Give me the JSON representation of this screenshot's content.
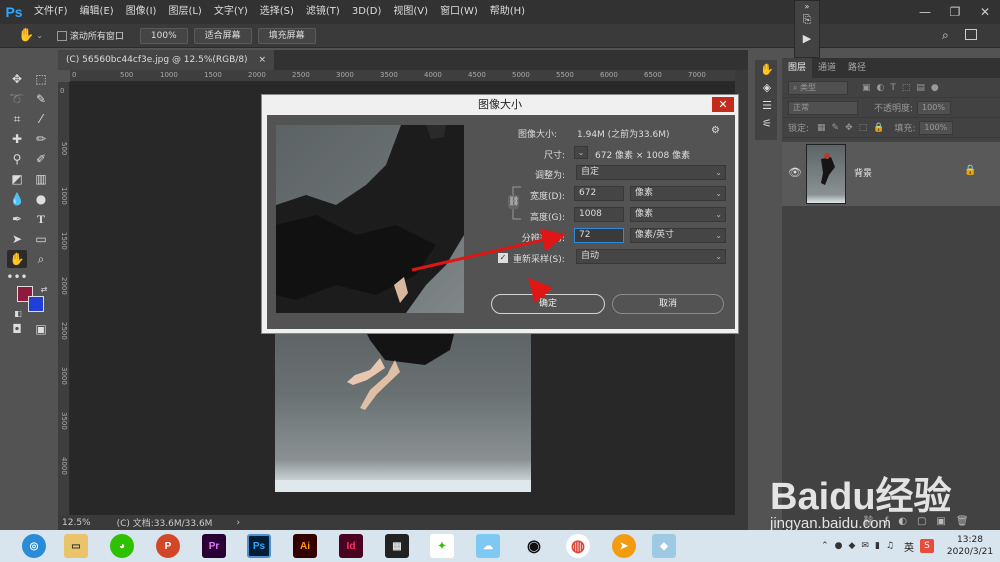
{
  "app": {
    "logo": "Ps"
  },
  "menu": [
    "文件(F)",
    "编辑(E)",
    "图像(I)",
    "图层(L)",
    "文字(Y)",
    "选择(S)",
    "滤镜(T)",
    "3D(D)",
    "视图(V)",
    "窗口(W)",
    "帮助(H)"
  ],
  "window_controls": {
    "minimize": "—",
    "restore": "❐",
    "close": "✕"
  },
  "options_bar": {
    "scroll_all_label": "滚动所有窗口",
    "zoom_100": "100%",
    "fit_screen": "适合屏幕",
    "fill_screen": "填充屏幕"
  },
  "document": {
    "tab_title": "(C) 56560bc44cf3e.jpg @ 12.5%(RGB/8)",
    "tab_close": "×",
    "zoom": "12.5%",
    "doc_size": "(C) 文档:33.6M/33.6M",
    "ruler_h": [
      "0",
      "500",
      "1000",
      "1500",
      "2000",
      "2500",
      "3000",
      "3500",
      "4000",
      "4500",
      "5000",
      "5500",
      "6000",
      "6500",
      "7000"
    ],
    "ruler_v": [
      "0",
      "500",
      "1000",
      "1500",
      "2000",
      "2500",
      "3000",
      "3500",
      "4000"
    ]
  },
  "layers_panel": {
    "tabs": [
      "图层",
      "通道",
      "路径"
    ],
    "kind_label": "类型",
    "blend_mode": "正常",
    "opacity_label": "不透明度:",
    "opacity_value": "100%",
    "lock_label": "锁定:",
    "fill_label": "填充:",
    "fill_value": "100%",
    "layer_name": "背景"
  },
  "dialog": {
    "title": "图像大小",
    "close": "✕",
    "image_size_label": "图像大小:",
    "image_size_value": "1.94M (之前为33.6M)",
    "dimensions_label": "尺寸:",
    "dimensions_value": "672 像素 × 1008 像素",
    "fit_to_label": "调整为:",
    "fit_to_value": "自定",
    "width_label": "宽度(D):",
    "width_value": "672",
    "width_unit": "像素",
    "height_label": "高度(G):",
    "height_value": "1008",
    "height_unit": "像素",
    "resolution_label": "分辨率(R):",
    "resolution_value": "72",
    "resolution_unit": "像素/英寸",
    "resample_label": "重新采样(S):",
    "resample_value": "自动",
    "ok_button": "确定",
    "cancel_button": "取消"
  },
  "taskbar": {
    "apps": [
      "Pr",
      "Ps",
      "Ai",
      "Id"
    ],
    "ime": "英",
    "time": "13:28",
    "date": "2020/3/21"
  },
  "watermark": {
    "brand": "Baidu经验",
    "url": "jingyan.baidu.com"
  },
  "colors": {
    "accent": "#31a8ff",
    "annotation_arrow": "#e01515",
    "foreground": "#8e1a3d",
    "background": "#1f3fd6"
  }
}
